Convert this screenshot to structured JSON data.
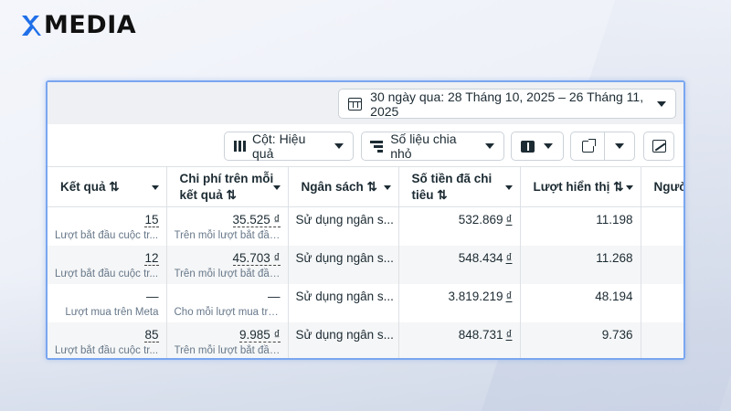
{
  "brand": {
    "name": "MEDIA"
  },
  "date_range": {
    "label": "30 ngày qua: 28 Tháng 10, 2025 – 26 Tháng 11, 2025"
  },
  "toolbar": {
    "columns_label": "Cột: Hiệu quả",
    "breakdown_label": "Số liệu chia nhỏ"
  },
  "table": {
    "headers": [
      "Kết quả ⇅",
      "Chi phí trên mỗi kết quả ⇅",
      "Ngân sách ⇅",
      "Số tiền đã chi tiêu ⇅",
      "Lượt hiển thị ⇅",
      "Người ⇅"
    ],
    "rows": [
      {
        "result": "15",
        "result_sub": "Lượt bắt đầu cuộc tr...",
        "cpr": "35.525 ₫",
        "cpr_sub": "Trên mỗi lượt bắt đầu...",
        "budget": "Sử dụng ngân s...",
        "spent": "532.869",
        "impressions": "11.198"
      },
      {
        "result": "12",
        "result_sub": "Lượt bắt đầu cuộc tr...",
        "cpr": "45.703 ₫",
        "cpr_sub": "Trên mỗi lượt bắt đầu...",
        "budget": "Sử dụng ngân s...",
        "spent": "548.434",
        "impressions": "11.268"
      },
      {
        "result": "—",
        "result_sub": "Lượt mua trên Meta",
        "cpr": "—",
        "cpr_sub": "Cho mỗi lượt mua trê...",
        "budget": "Sử dụng ngân s...",
        "spent": "3.819.219",
        "impressions": "48.194"
      },
      {
        "result": "85",
        "result_sub": "Lượt bắt đầu cuộc tr...",
        "cpr": "9.985 ₫",
        "cpr_sub": "Trên mỗi lượt bắt đầu...",
        "budget": "Sử dụng ngân s...",
        "spent": "848.731",
        "impressions": "9.736"
      }
    ],
    "currency": "₫"
  },
  "colors": {
    "panel_border": "#7aa6f0",
    "logo_accent": "#1f6fe8",
    "text": "#1c2b33"
  },
  "icons": [
    "logo-icon",
    "calendar-icon",
    "columns-icon",
    "breakdown-icon",
    "reports-icon",
    "export-icon",
    "chart-icon",
    "sort-icon",
    "chevron-down-icon"
  ]
}
